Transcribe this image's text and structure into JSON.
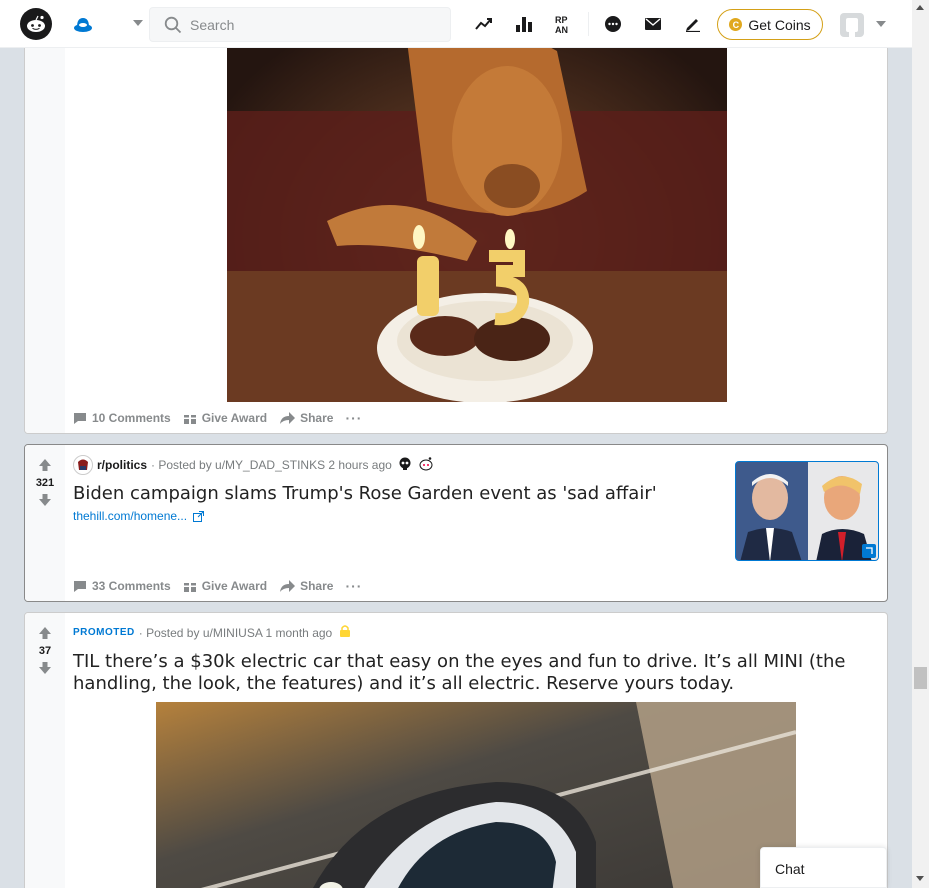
{
  "header": {
    "search_placeholder": "Search",
    "get_coins_label": "Get Coins",
    "coin_symbol": "C",
    "icons": [
      "reddit-logo-icon",
      "home-feed-icon",
      "trending-icon",
      "stats-icon",
      "rpan-icon",
      "chat-icon",
      "mail-icon",
      "pencil-icon"
    ],
    "rpan_label": "RP\nAN"
  },
  "posts": [
    {
      "comments_label": "10 Comments",
      "award_label": "Give Award",
      "share_label": "Share",
      "more_label": "···"
    },
    {
      "votes": "321",
      "subreddit": "r/politics",
      "posted_by": "· Posted by u/MY_DAD_STINKS 2 hours ago",
      "title": "Biden campaign slams Trump's Rose Garden event as 'sad affair'",
      "link": "thehill.com/homene...",
      "comments_label": "33 Comments",
      "award_label": "Give Award",
      "share_label": "Share",
      "more_label": "···"
    },
    {
      "votes": "37",
      "promoted_label": "PROMOTED",
      "posted_by": "· Posted by u/MINIUSA 1 month ago",
      "title": "TIL there’s a $30k electric car that easy on the eyes and fun to drive. It’s all MINI (the handling, the look, the features) and it’s all electric. Reserve yours today."
    }
  ],
  "chat_label": "Chat",
  "colors": {
    "accent": "#0079d3",
    "upvote": "#878a8c",
    "coin": "#e0a81e",
    "page_bg": "#dae0e6"
  }
}
